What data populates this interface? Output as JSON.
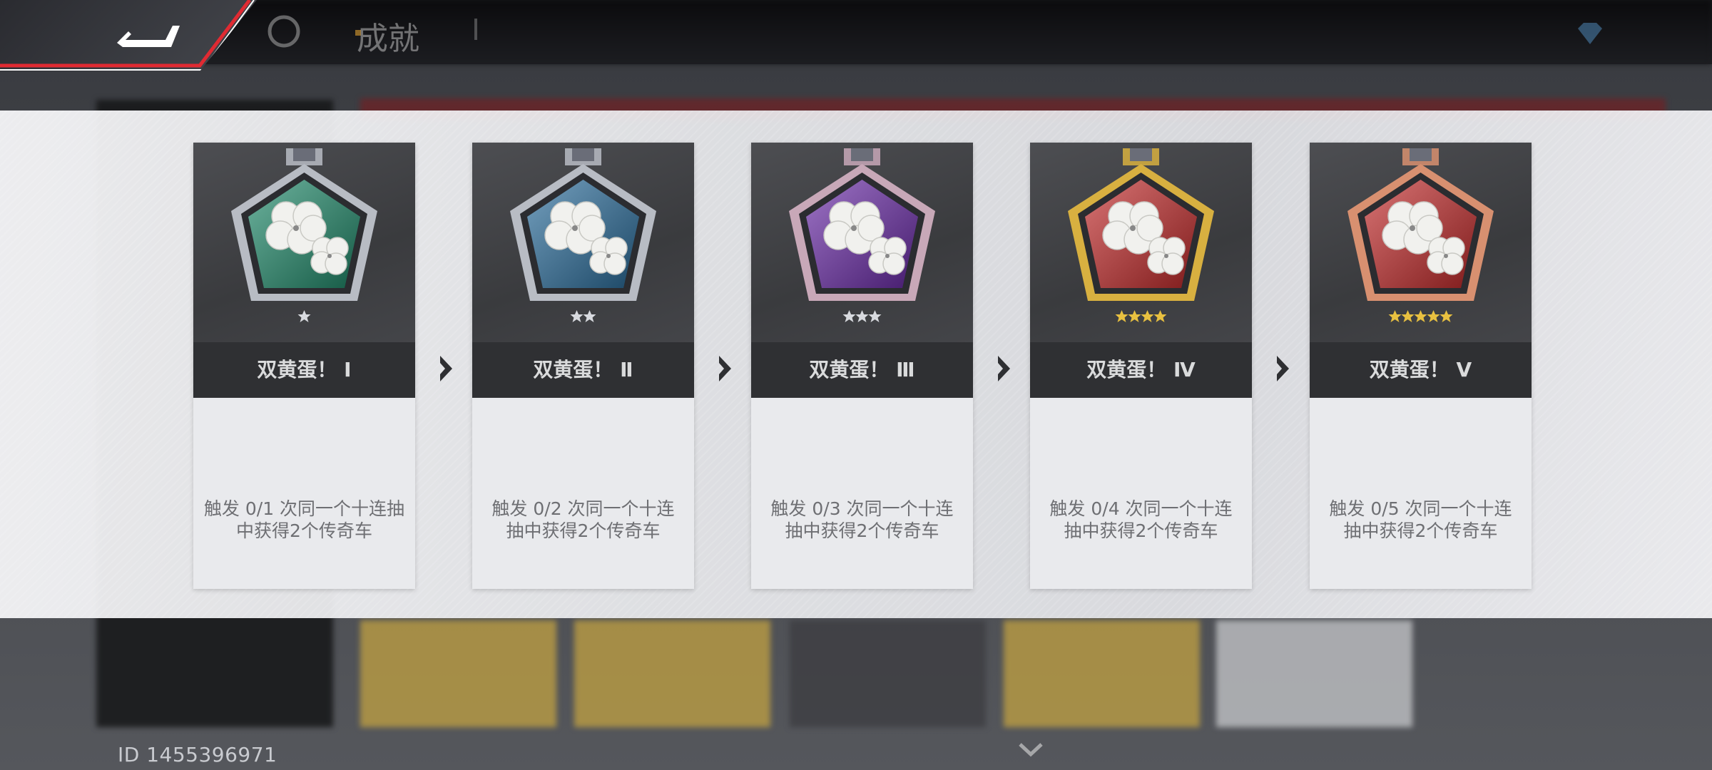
{
  "header": {
    "title": "成就",
    "back_icon": "back-arrow-icon",
    "home_icon": "home-icon",
    "currency_icon": "diamond-icon"
  },
  "user": {
    "id_text": "ID 1455396971"
  },
  "modal": {
    "medals": [
      {
        "name": "双黄蛋！ Ⅰ",
        "desc_line1": "触发 0/1 次同一个十连抽",
        "desc_line2": "中获得2个传奇车",
        "tier_color": "#1f8a6a",
        "frame_color": "#b8bcc4",
        "stars": 1
      },
      {
        "name": "双黄蛋！ Ⅱ",
        "desc_line1": "触发 0/2 次同一个十连",
        "desc_line2": "抽中获得2个传奇车",
        "tier_color": "#2a6d9c",
        "frame_color": "#b8bcc4",
        "stars": 2
      },
      {
        "name": "双黄蛋！ Ⅲ",
        "desc_line1": "触发 0/3 次同一个十连",
        "desc_line2": "抽中获得2个传奇车",
        "tier_color": "#6a2aa8",
        "frame_color": "#c8a8b8",
        "stars": 3
      },
      {
        "name": "双黄蛋！ Ⅳ",
        "desc_line1": "触发 0/4 次同一个十连",
        "desc_line2": "抽中获得2个传奇车",
        "tier_color": "#c42a2a",
        "frame_color": "#d8b040",
        "stars": 4
      },
      {
        "name": "双黄蛋！ Ⅴ",
        "desc_line1": "触发 0/5 次同一个十连",
        "desc_line2": "抽中获得2个传奇车",
        "tier_color": "#c42a2a",
        "frame_color": "#d89070",
        "stars": 5
      }
    ],
    "arrow_icon": "chevron-right-icon"
  }
}
